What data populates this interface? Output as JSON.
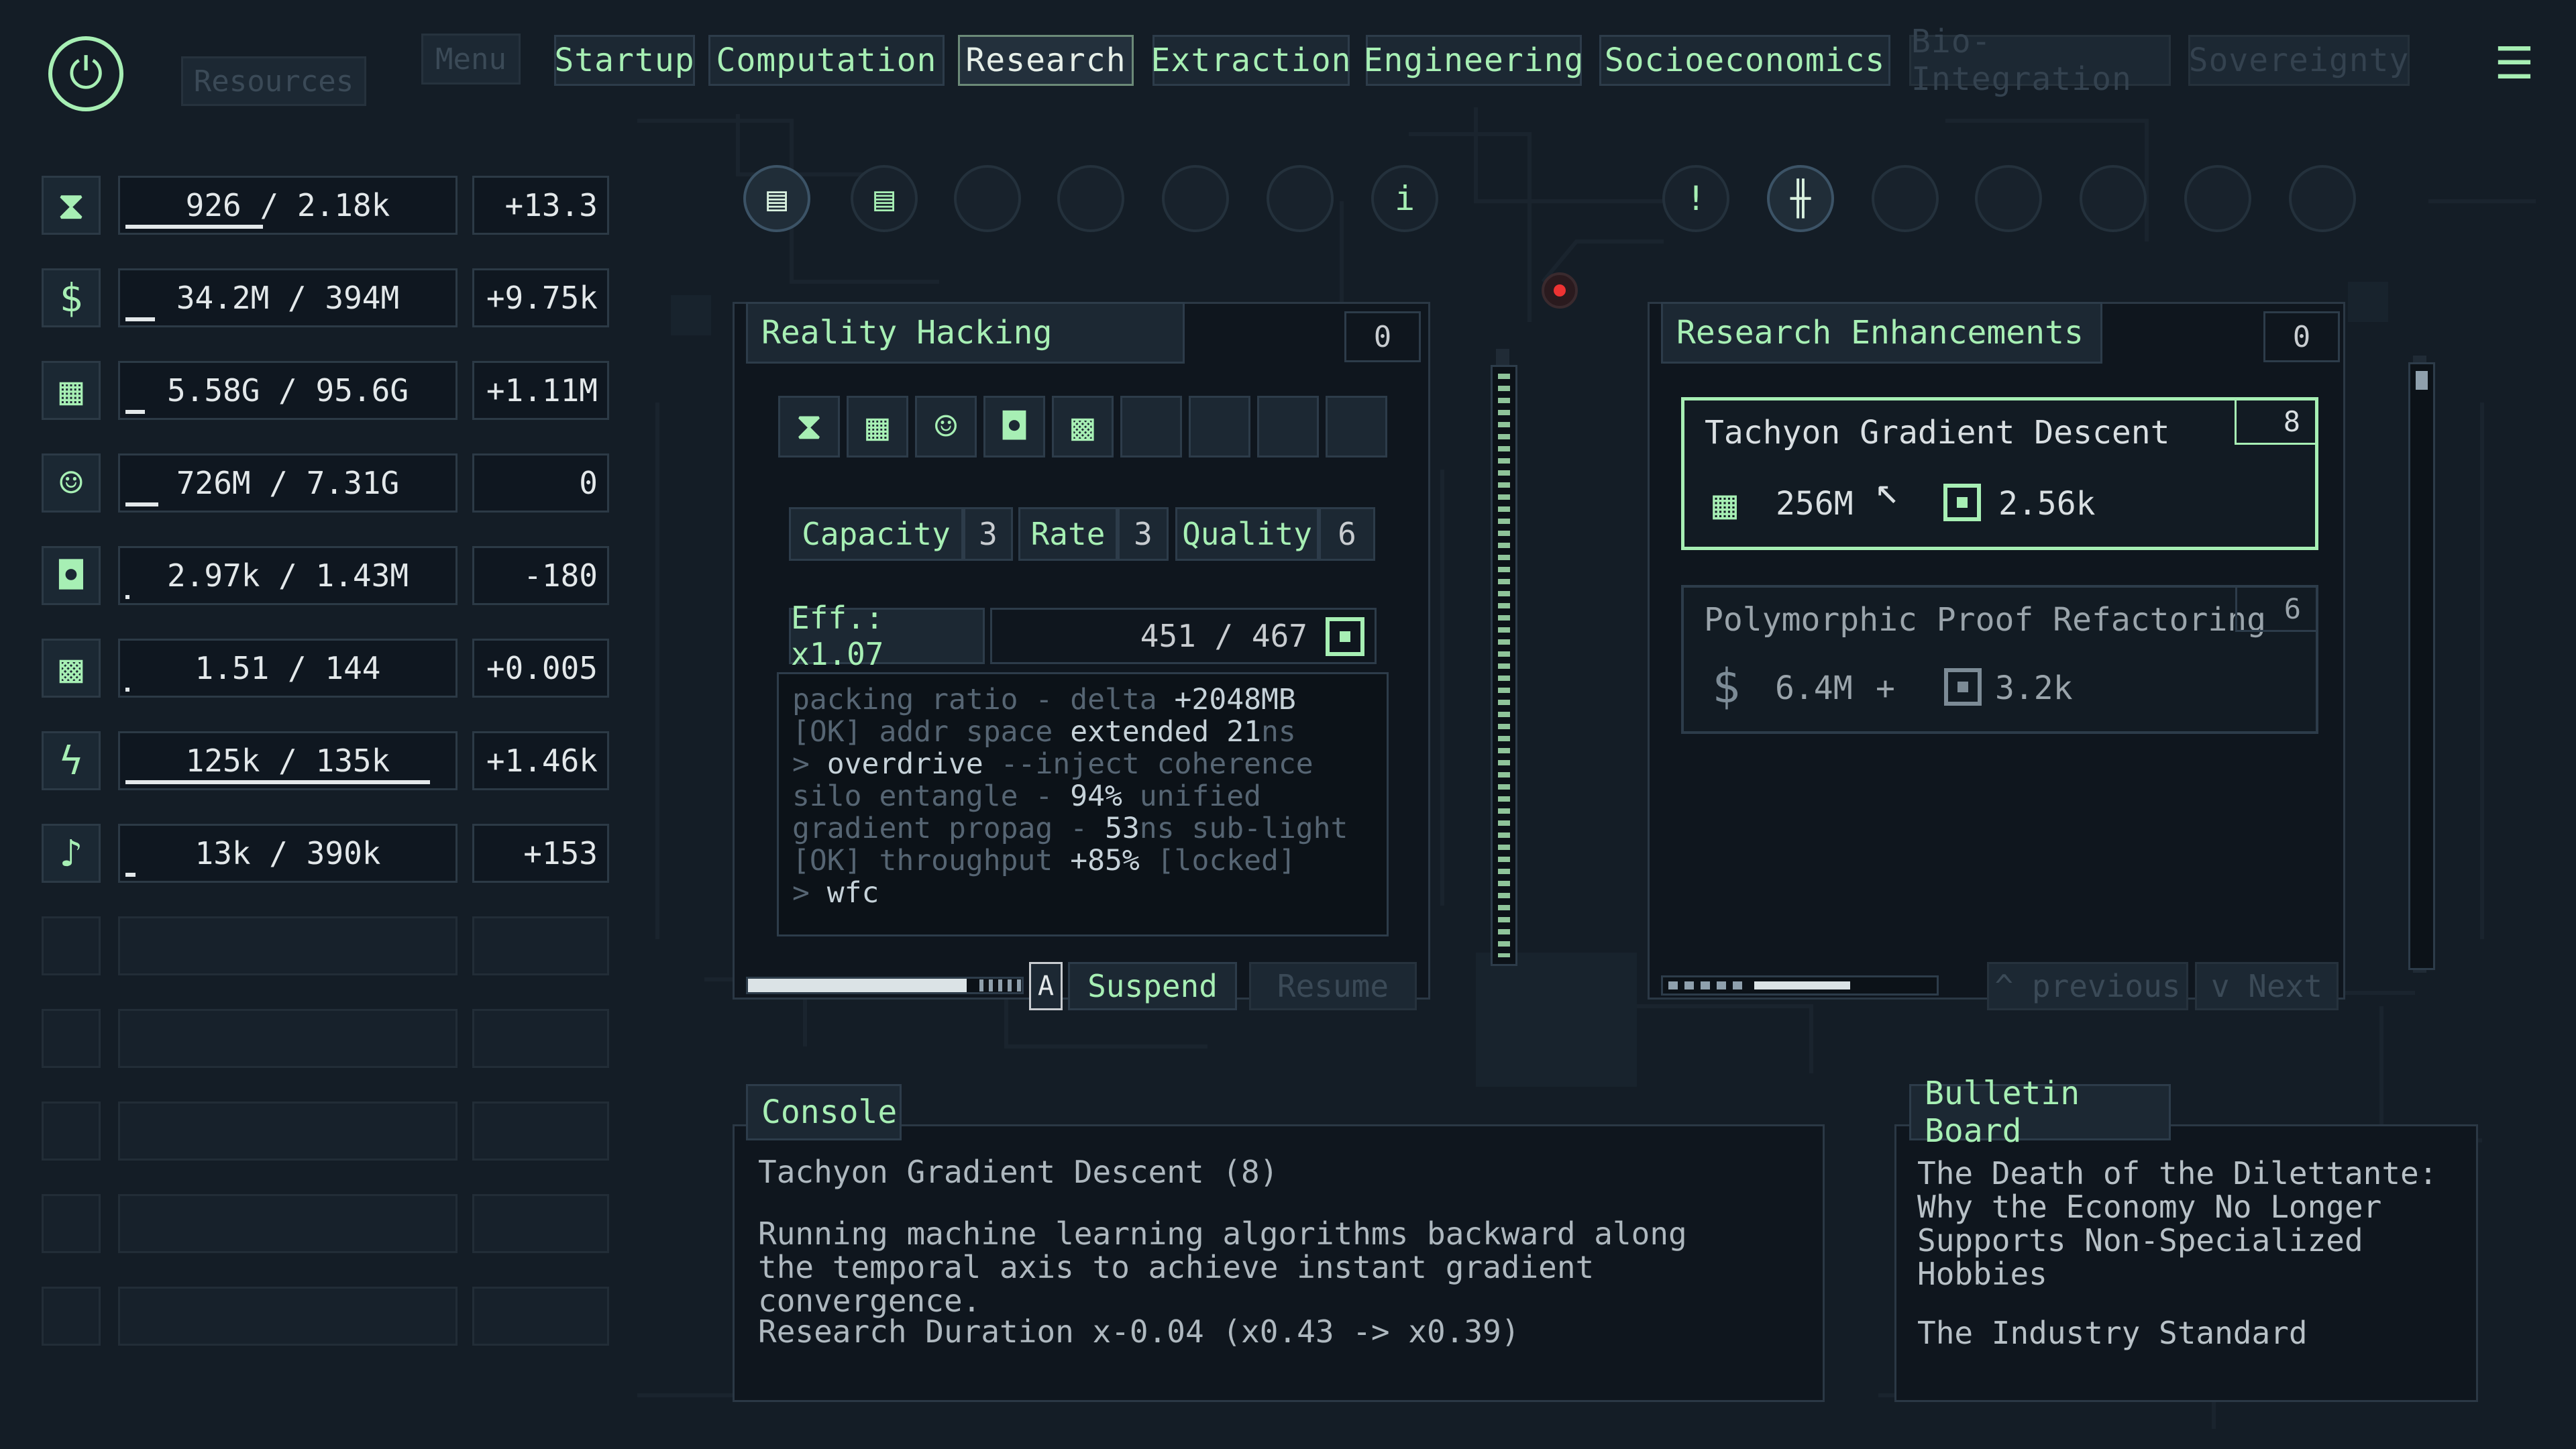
{
  "top": {
    "resources_label": "Resources",
    "menu_label": "Menu",
    "tabs": [
      {
        "label": "Startup",
        "state": "normal"
      },
      {
        "label": "Computation",
        "state": "normal"
      },
      {
        "label": "Research",
        "state": "active"
      },
      {
        "label": "Extraction",
        "state": "normal"
      },
      {
        "label": "Engineering",
        "state": "normal"
      },
      {
        "label": "Socioeconomics",
        "state": "normal"
      },
      {
        "label": "Bio-Integration",
        "state": "disabled"
      },
      {
        "label": "Sovereignty",
        "state": "disabled"
      }
    ]
  },
  "resources": [
    {
      "icon": "hourglass-icon",
      "glyph": "⧗",
      "value": "926 / 2.18k",
      "rate": "+13.3",
      "fill": 0.42
    },
    {
      "icon": "dollar-icon",
      "glyph": "$",
      "value": "34.2M / 394M",
      "rate": "+9.75k",
      "fill": 0.09
    },
    {
      "icon": "calendar-icon",
      "glyph": "▦",
      "value": "5.58G / 95.6G",
      "rate": "+1.11M",
      "fill": 0.06
    },
    {
      "icon": "face-icon",
      "glyph": "☺",
      "value": "726M / 7.31G",
      "rate": "0",
      "fill": 0.1
    },
    {
      "icon": "chip-icon",
      "glyph": "◘",
      "value": "2.97k / 1.43M",
      "rate": "-180",
      "fill": 0.01
    },
    {
      "icon": "grid-icon",
      "glyph": "▩",
      "value": "1.51 / 144",
      "rate": "+0.005",
      "fill": 0.01
    },
    {
      "icon": "lightning-icon",
      "glyph": "ϟ",
      "value": "125k / 135k",
      "rate": "+1.46k",
      "fill": 0.93
    },
    {
      "icon": "music-note-icon",
      "glyph": "♪",
      "value": "13k / 390k",
      "rate": "+153",
      "fill": 0.03
    }
  ],
  "nodes": [
    {
      "glyph": "▤",
      "on": true
    },
    {
      "glyph": "▤",
      "on": false
    },
    {
      "glyph": "",
      "on": false
    },
    {
      "glyph": "",
      "on": false
    },
    {
      "glyph": "",
      "on": false
    },
    {
      "glyph": "",
      "on": false
    },
    {
      "glyph": "i",
      "on": false
    },
    {
      "glyph": "!",
      "on": false
    },
    {
      "glyph": "╫",
      "on": true
    },
    {
      "glyph": "",
      "on": false
    },
    {
      "glyph": "",
      "on": false
    },
    {
      "glyph": "",
      "on": false
    },
    {
      "glyph": "",
      "on": false
    },
    {
      "glyph": "",
      "on": false
    }
  ],
  "reality": {
    "title": "Reality Hacking",
    "count": "0",
    "slots": [
      "⧗",
      "▦",
      "☺",
      "◘",
      "▩",
      "",
      "",
      "",
      ""
    ],
    "capacity_label": "Capacity",
    "capacity": "3",
    "rate_label": "Rate",
    "rate": "3",
    "quality_label": "Quality",
    "quality": "6",
    "eff": "Eff.: x1.07",
    "progress": "451 / 467",
    "log": [
      {
        "dim": "packing ratio - delta ",
        "hi": "+2048MB",
        "tail": ""
      },
      {
        "dim": "[OK] addr space ",
        "hi": "extended 21",
        "tail": "ns"
      },
      {
        "dim": "> ",
        "hi": "overdrive",
        "tail": " --inject coherence"
      },
      {
        "dim": "silo entangle - ",
        "hi": "94%",
        "tail": " unified"
      },
      {
        "dim": "gradient propag - ",
        "hi": "53",
        "tail": "ns sub-light"
      },
      {
        "dim": "[OK] throughput ",
        "hi": "+85%",
        "tail": " [locked]"
      },
      {
        "dim": "> ",
        "hi": "wfc",
        "tail": ""
      }
    ],
    "progress_fill": 0.8,
    "auto_label": "A",
    "suspend_label": "Suspend",
    "resume_label": "Resume"
  },
  "enhancements": {
    "title": "Research Enhancements",
    "count": "0",
    "items": [
      {
        "name": "Tachyon Gradient Descent",
        "level": "8",
        "cost1": "256M",
        "icon1": "calendar-icon",
        "cost2": "2.56k",
        "icon2": "chip-icon",
        "selected": true
      },
      {
        "name": "Polymorphic Proof Refactoring",
        "level": "6",
        "cost1": "6.4M",
        "icon1": "dollar-icon",
        "sep": "+",
        "cost2": "3.2k",
        "icon2": "chip-icon",
        "selected": false
      }
    ],
    "previous_label": "^ previous",
    "next_label": "v Next",
    "scroll_fill": 0.55
  },
  "console": {
    "title": "Console",
    "heading": "Tachyon Gradient Descent (8)",
    "body": "Running machine learning algorithms backward along the temporal axis to achieve instant gradient convergence.",
    "effect": "Research Duration x-0.04 (x0.43 -> x0.39)"
  },
  "bulletin": {
    "title": "Bulletin Board",
    "headline": "The Death of the Dilettante: Why the Economy No Longer Supports Non-Specialized Hobbies",
    "source": "The Industry Standard"
  },
  "colors": {
    "accent": "#a7efb4",
    "bg": "#141d26",
    "panel": "#0f161e",
    "border": "#2d3c4a"
  }
}
